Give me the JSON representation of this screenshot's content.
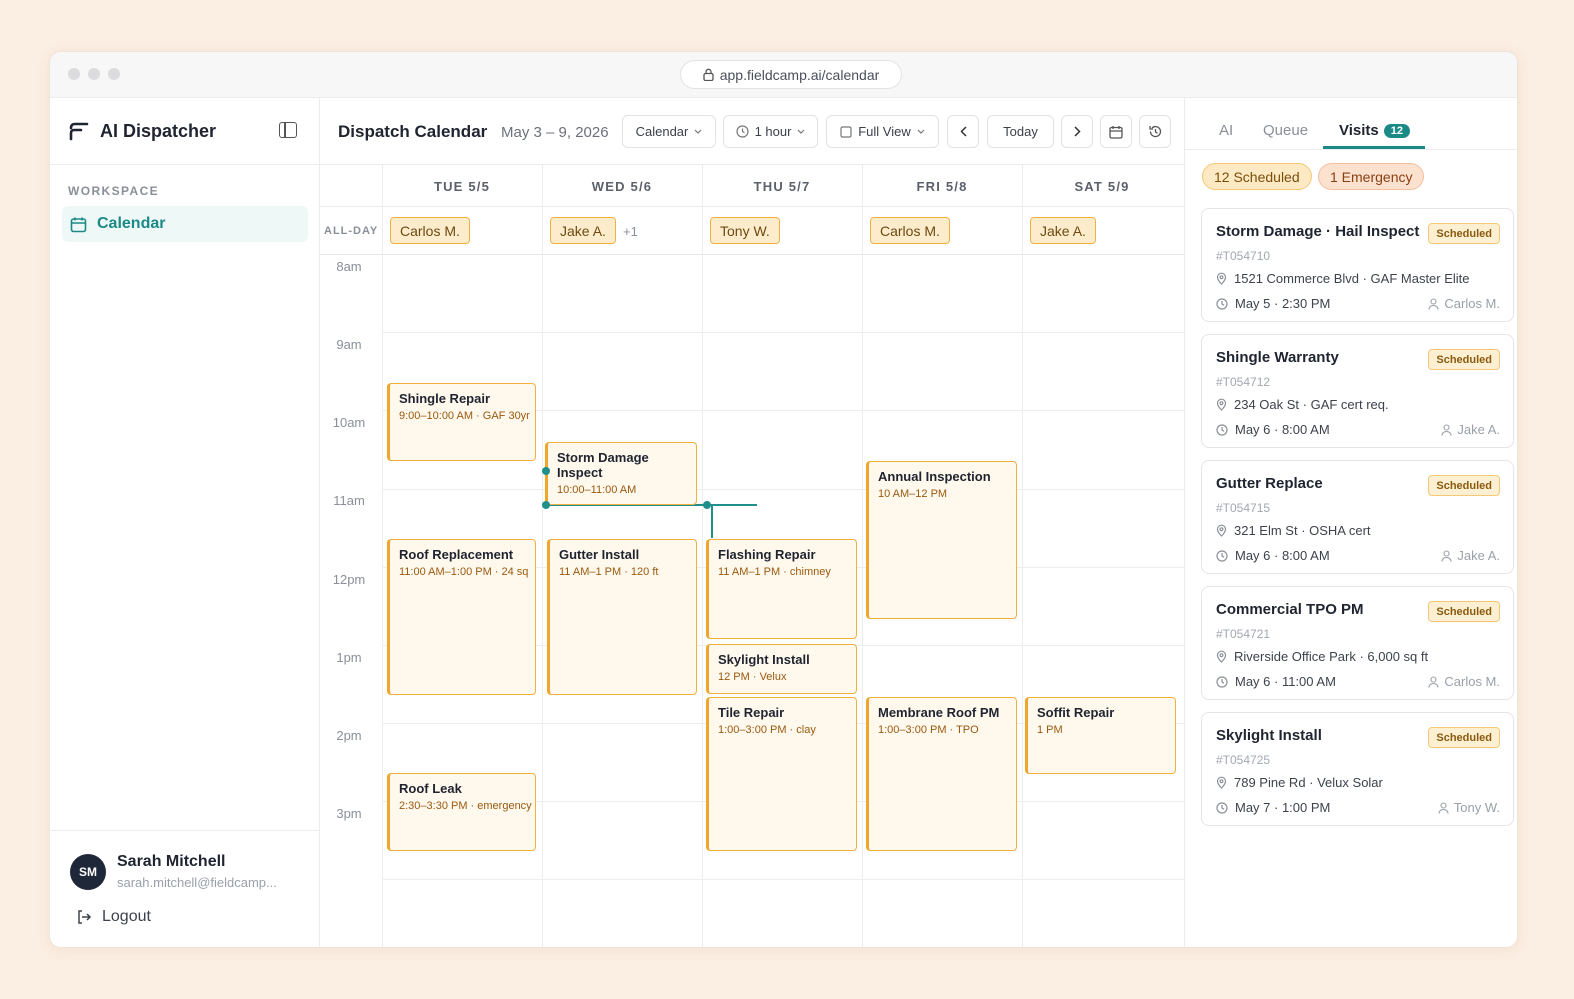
{
  "browser": {
    "url": "app.fieldcamp.ai/calendar"
  },
  "sidebar": {
    "brand": "AI Dispatcher",
    "section_label": "WORKSPACE",
    "nav_calendar": "Calendar",
    "user": {
      "initials": "SM",
      "name": "Sarah Mitchell",
      "email": "sarah.mitchell@fieldcamp..."
    },
    "logout_label": "Logout"
  },
  "toolbar": {
    "title": "Dispatch Calendar",
    "range": "May 3 – 9, 2026",
    "view_select": "Calendar",
    "interval_select": "1 hour",
    "view_mode_select": "Full View",
    "today_label": "Today"
  },
  "calendar": {
    "days": [
      "TUE 5/5",
      "WED 5/6",
      "THU 5/7",
      "FRI 5/8",
      "SAT 5/9"
    ],
    "allday_label": "ALL-DAY",
    "allday": [
      {
        "name": "Carlos M.",
        "extra": ""
      },
      {
        "name": "Jake A.",
        "extra": "+1"
      },
      {
        "name": "Tony W.",
        "extra": ""
      },
      {
        "name": "Carlos M.",
        "extra": ""
      },
      {
        "name": "Jake A.",
        "extra": ""
      }
    ],
    "hours": [
      "8am",
      "9am",
      "10am",
      "11am",
      "12pm",
      "1pm",
      "2pm",
      "3pm"
    ],
    "events": [
      {
        "title": "Shingle Repair",
        "sub": "9:00–10:00 AM · GAF 30yr"
      },
      {
        "title": "Roof Replacement",
        "sub": "11:00 AM–1:00 PM · 24 sq"
      },
      {
        "title": "Roof Leak",
        "sub": "2:30–3:30 PM · emergency"
      },
      {
        "title": "Storm Damage Inspect",
        "sub": "10:00–11:00 AM"
      },
      {
        "title": "Gutter Install",
        "sub": "11 AM–1 PM · 120 ft"
      },
      {
        "title": "Flashing Repair",
        "sub": "11 AM–1 PM · chimney"
      },
      {
        "title": "Skylight Install",
        "sub": "12 PM · Velux"
      },
      {
        "title": "Tile Repair",
        "sub": "1:00–3:00 PM · clay"
      },
      {
        "title": "Annual Inspection",
        "sub": "10 AM–12 PM"
      },
      {
        "title": "Membrane Roof PM",
        "sub": "1:00–3:00 PM · TPO"
      },
      {
        "title": "Soffit Repair",
        "sub": "1 PM"
      }
    ]
  },
  "panel": {
    "tabs": [
      "AI",
      "Queue",
      "Visits"
    ],
    "visits_count": "12",
    "pill_scheduled": "12 Scheduled",
    "pill_emergency": "1 Emergency",
    "cards": [
      {
        "title": "Storm Damage · Hail Inspect",
        "status": "Scheduled",
        "id": "#T054710",
        "address": "1521 Commerce Blvd · GAF Master Elite",
        "when": "May 5 · 2:30 PM",
        "person": "Carlos M."
      },
      {
        "title": "Shingle Warranty",
        "status": "Scheduled",
        "id": "#T054712",
        "address": "234 Oak St · GAF cert req.",
        "when": "May 6 · 8:00 AM",
        "person": "Jake A."
      },
      {
        "title": "Gutter Replace",
        "status": "Scheduled",
        "id": "#T054715",
        "address": "321 Elm St · OSHA cert",
        "when": "May 6 · 8:00 AM",
        "person": "Jake A."
      },
      {
        "title": "Commercial TPO PM",
        "status": "Scheduled",
        "id": "#T054721",
        "address": "Riverside Office Park · 6,000 sq ft",
        "when": "May 6 · 11:00 AM",
        "person": "Carlos M."
      },
      {
        "title": "Skylight Install",
        "status": "Scheduled",
        "id": "#T054725",
        "address": "789 Pine Rd · Velux Solar",
        "when": "May 7 · 1:00 PM",
        "person": "Tony W."
      }
    ]
  },
  "colors": {
    "accent": "#1b8a86",
    "event_border": "#f2b040",
    "event_fill": "#fff8ec"
  }
}
